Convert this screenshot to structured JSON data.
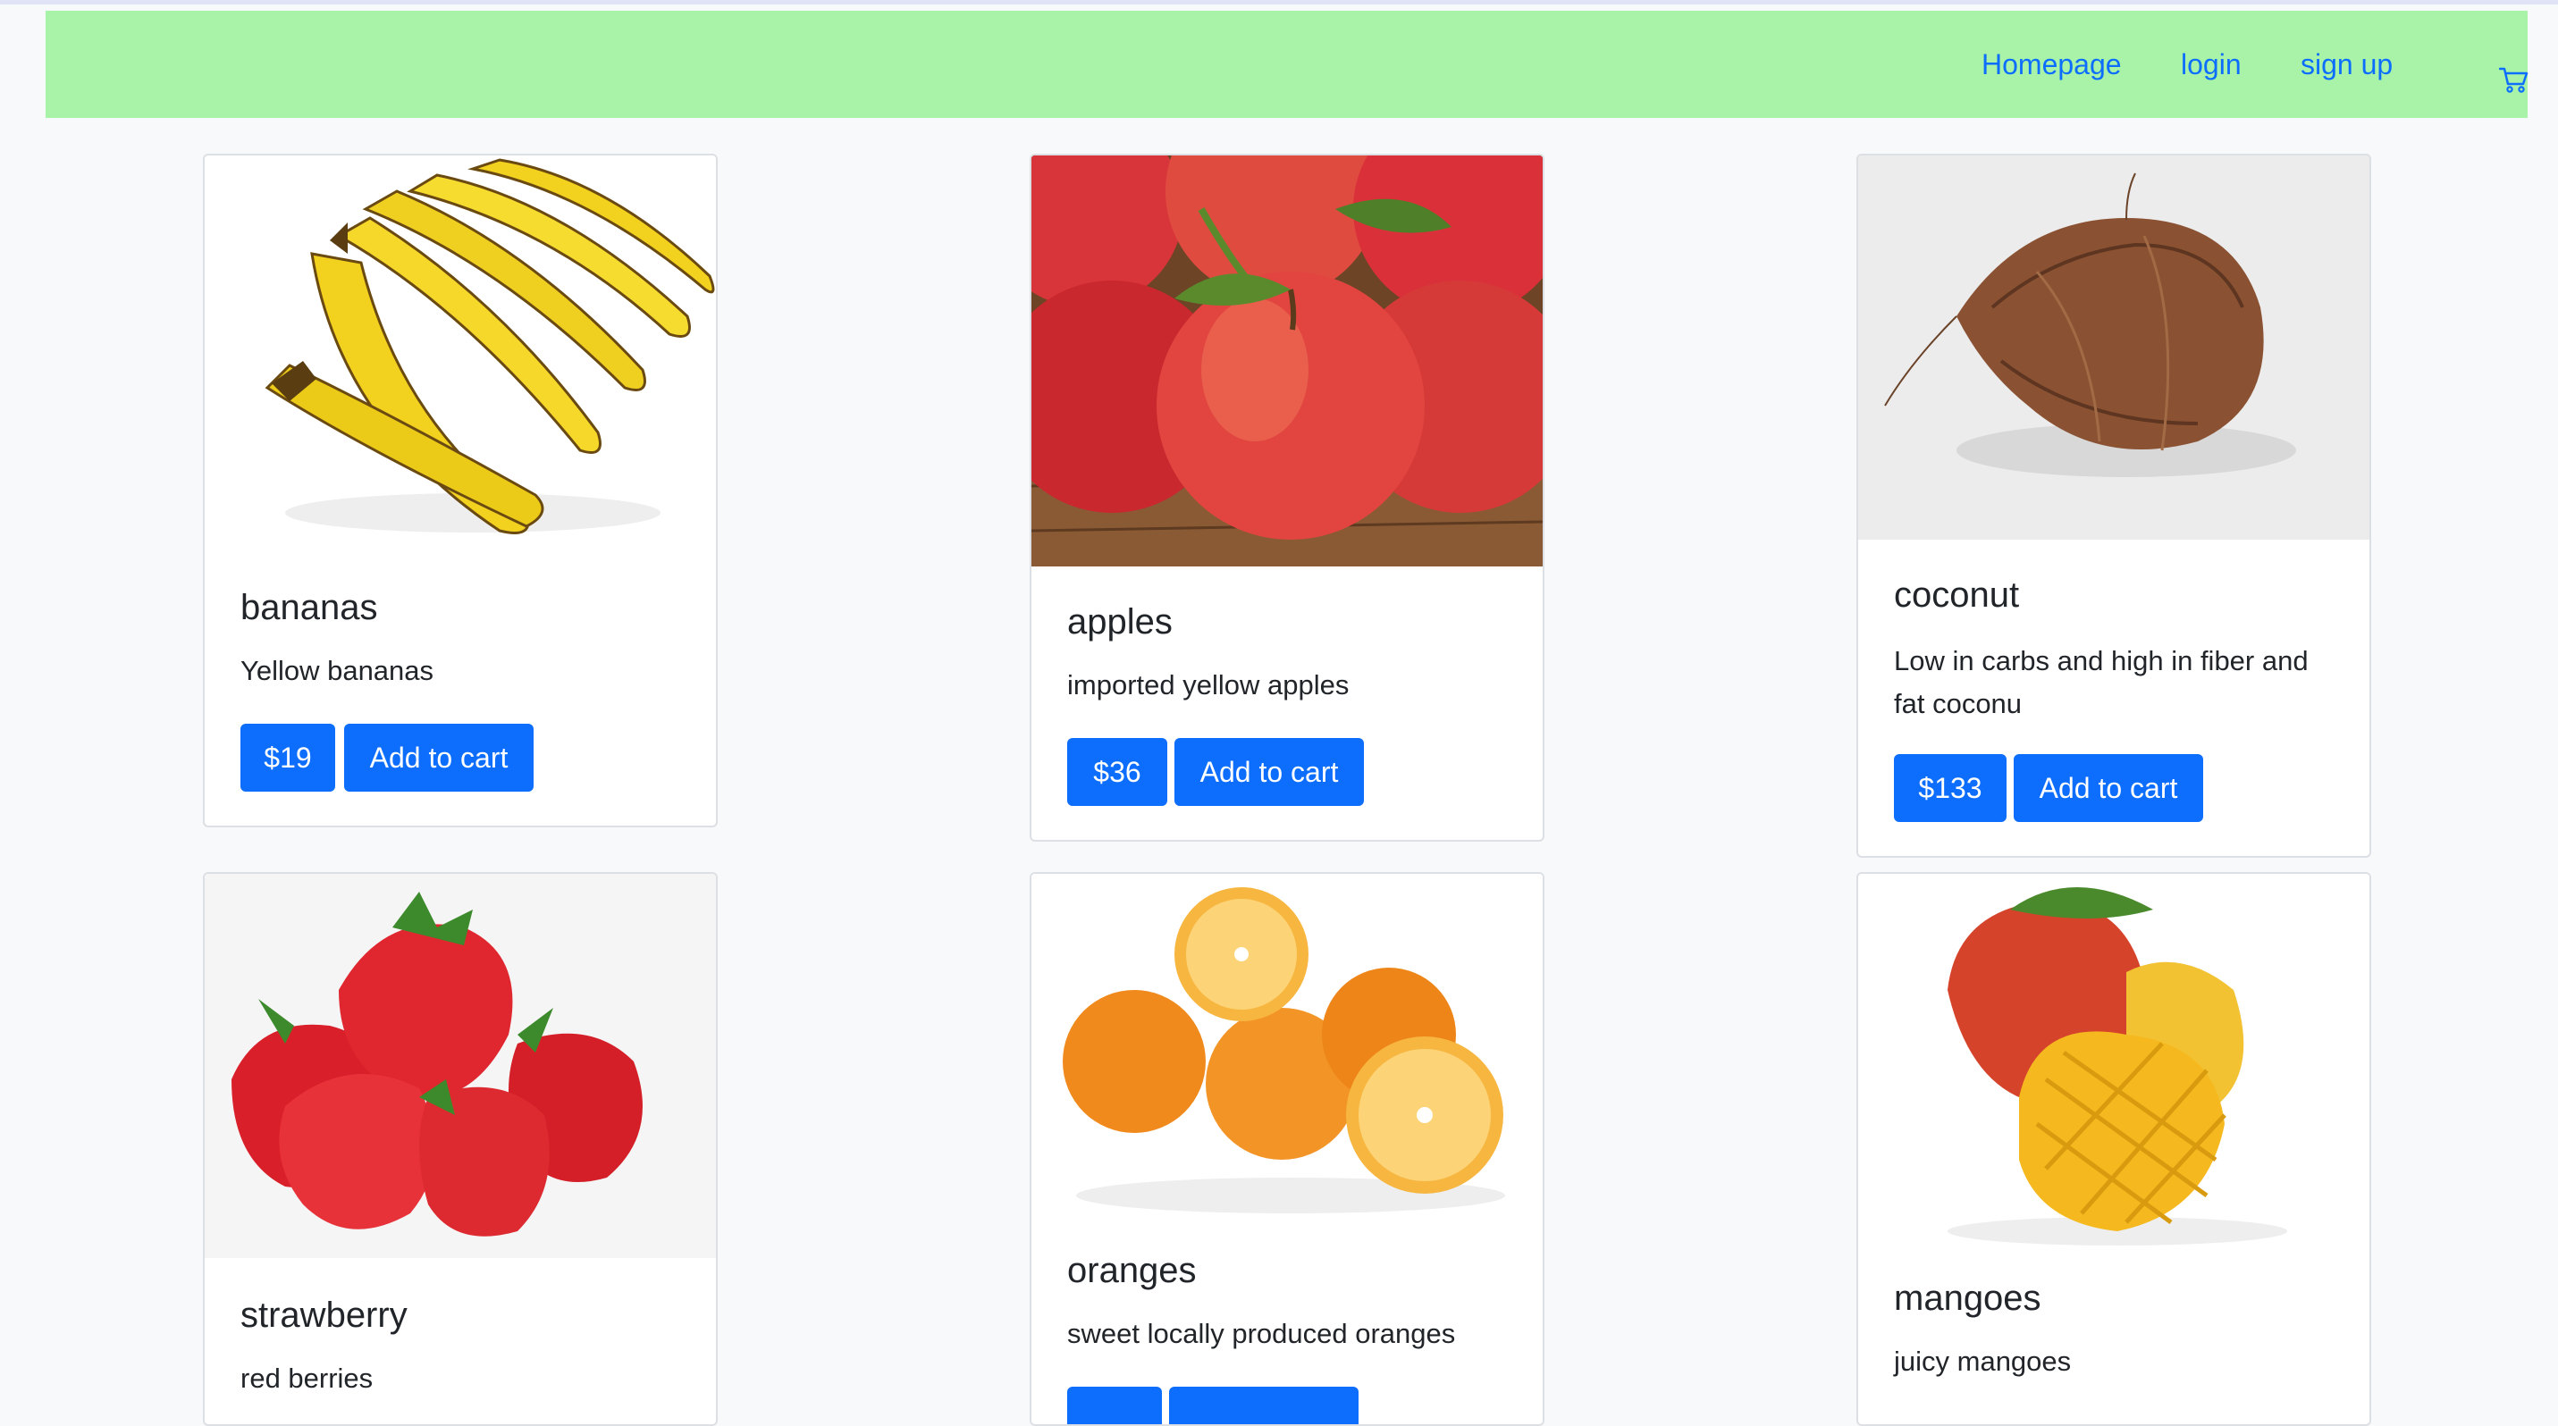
{
  "nav": {
    "links": [
      "Homepage",
      "login",
      "sign up"
    ],
    "cart_icon": "cart-icon"
  },
  "products": [
    {
      "name": "bananas",
      "description": "Yellow bananas",
      "price": "$19",
      "action": "Add to cart"
    },
    {
      "name": "apples",
      "description": "imported yellow apples",
      "price": "$36",
      "action": "Add to cart"
    },
    {
      "name": "coconut",
      "description": "Low in carbs and high in fiber and fat coconu",
      "price": "$133",
      "action": "Add to cart"
    },
    {
      "name": "strawberry",
      "description": "red berries",
      "price": "",
      "action": ""
    },
    {
      "name": "oranges",
      "description": "sweet locally produced oranges",
      "price": "",
      "action": ""
    },
    {
      "name": "mangoes",
      "description": "juicy mangoes",
      "price": "",
      "action": ""
    }
  ],
  "colors": {
    "navbar": "#a8f3a8",
    "link": "#0d6efd",
    "button": "#0d6efd",
    "page": "#f8f9fa"
  }
}
